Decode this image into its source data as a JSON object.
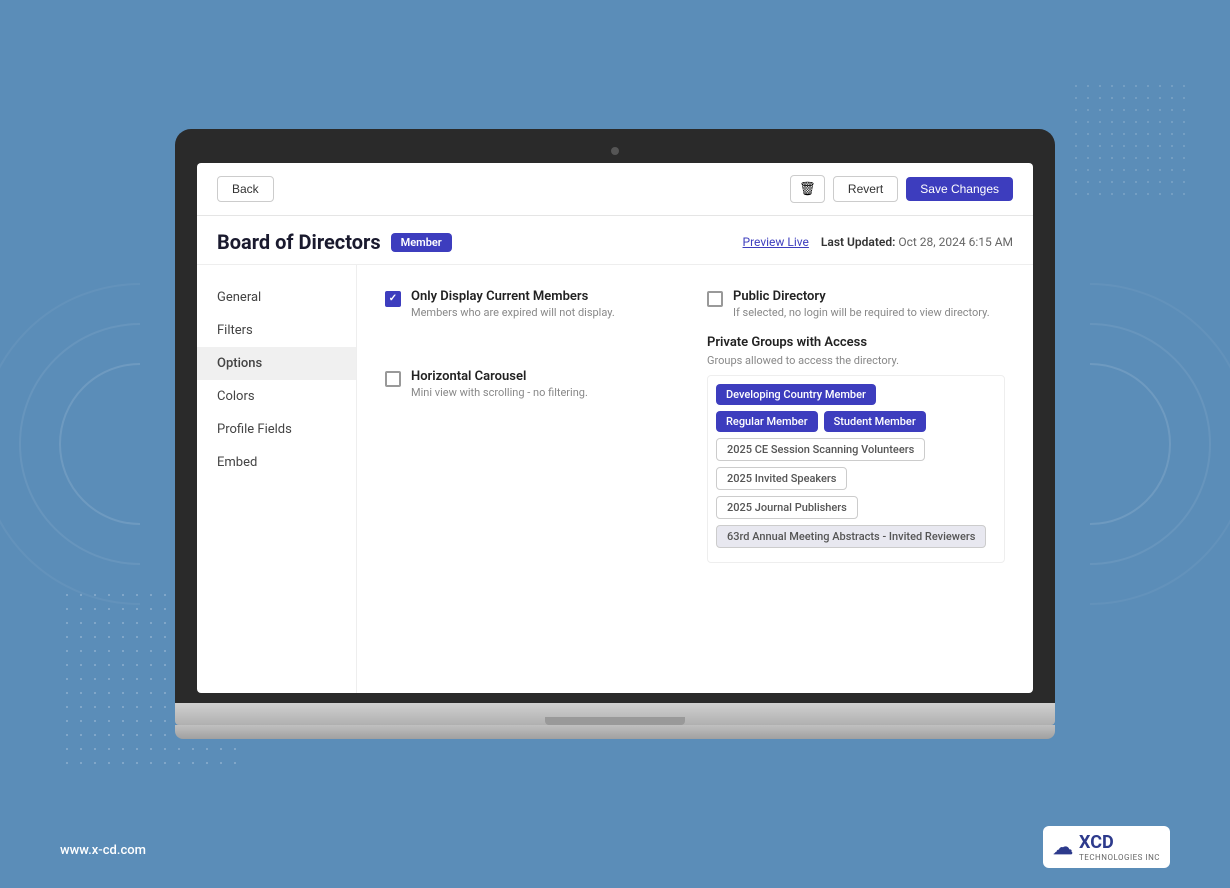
{
  "background": {
    "color": "#5b8db8"
  },
  "footer": {
    "website": "www.x-cd.com",
    "brand": "XCD",
    "brand_sub": "TECHNOLOGIES INC"
  },
  "topbar": {
    "back_label": "Back",
    "delete_icon": "🗑",
    "revert_label": "Revert",
    "save_label": "Save Changes"
  },
  "page": {
    "title": "Board of Directors",
    "badge": "Member",
    "preview_label": "Preview Live",
    "last_updated_label": "Last Updated:",
    "last_updated_value": "Oct 28, 2024 6:15 AM"
  },
  "sidebar": {
    "items": [
      {
        "id": "general",
        "label": "General",
        "active": false
      },
      {
        "id": "filters",
        "label": "Filters",
        "active": false
      },
      {
        "id": "options",
        "label": "Options",
        "active": true
      },
      {
        "id": "colors",
        "label": "Colors",
        "active": false
      },
      {
        "id": "profile-fields",
        "label": "Profile Fields",
        "active": false
      },
      {
        "id": "embed",
        "label": "Embed",
        "active": false
      }
    ]
  },
  "content": {
    "option1": {
      "label": "Only Display Current Members",
      "description": "Members who are expired will not display.",
      "checked": true
    },
    "option2": {
      "label": "Public Directory",
      "description": "If selected, no login will be required to view directory.",
      "checked": false
    },
    "private_groups": {
      "title": "Private Groups with Access",
      "description": "Groups allowed to access the directory.",
      "tags": [
        {
          "label": "Developing Country Member",
          "style": "purple"
        },
        {
          "label": "Regular Member",
          "style": "purple"
        },
        {
          "label": "Student Member",
          "style": "purple"
        },
        {
          "label": "2025 CE Session Scanning Volunteers",
          "style": "outline"
        },
        {
          "label": "2025 Invited Speakers",
          "style": "outline"
        },
        {
          "label": "2025 Journal Publishers",
          "style": "outline"
        },
        {
          "label": "63rd Annual Meeting Abstracts - Invited Reviewers",
          "style": "highlight"
        }
      ]
    },
    "carousel": {
      "label": "Horizontal Carousel",
      "description": "Mini view with scrolling - no filtering.",
      "checked": false
    }
  }
}
